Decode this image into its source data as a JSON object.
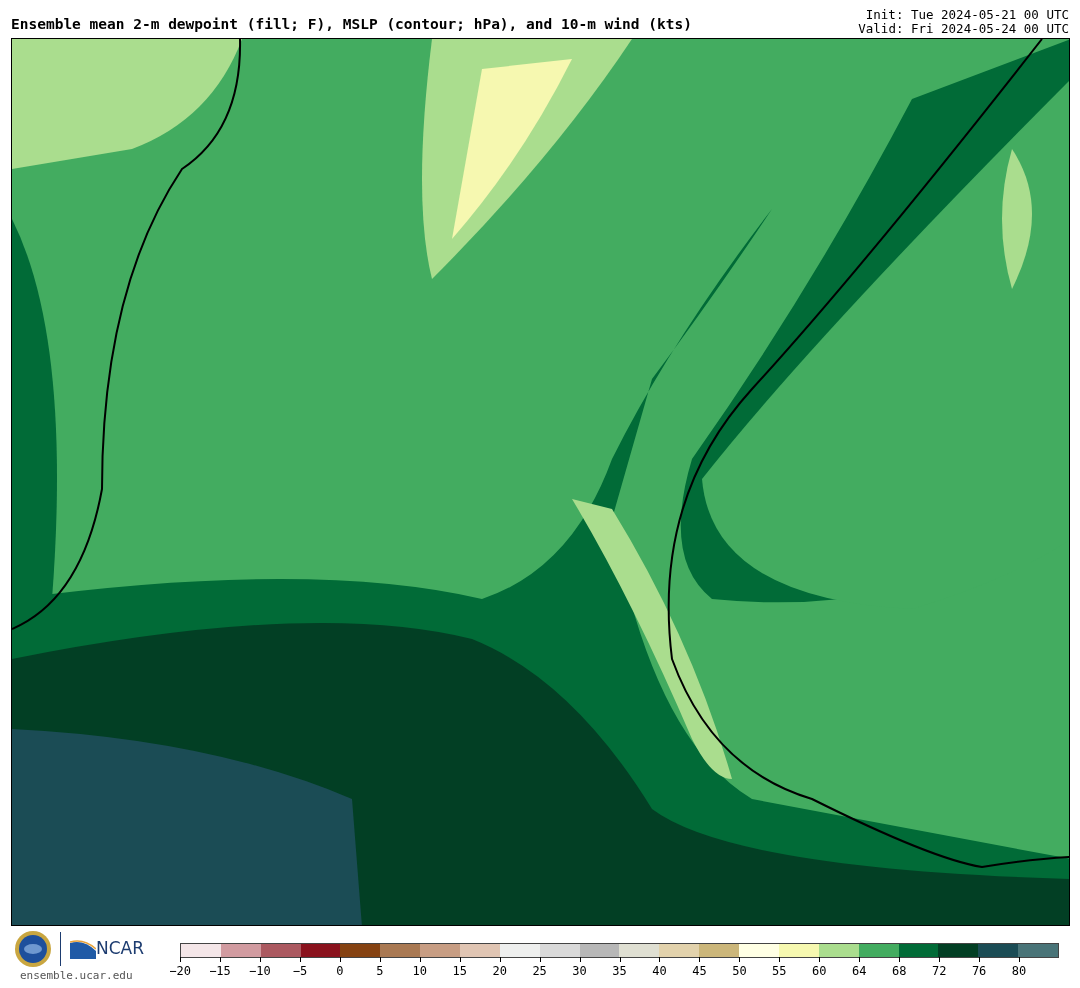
{
  "header": {
    "title": "Ensemble mean 2-m dewpoint (fill; F), MSLP (contour; hPa), and 10-m wind (kts)",
    "init": "Init: Tue 2024-05-21 00 UTC",
    "valid": "Valid: Fri 2024-05-24 00 UTC"
  },
  "footer": {
    "logo_text": "NCAR",
    "site": "ensemble.ucar.edu"
  },
  "colorbar": {
    "bins": [
      {
        "color": "#f4e6e8"
      },
      {
        "color": "#d19ba0"
      },
      {
        "color": "#ab5960"
      },
      {
        "color": "#8a121d"
      },
      {
        "color": "#854212"
      },
      {
        "color": "#a97953"
      },
      {
        "color": "#c79d83"
      },
      {
        "color": "#e0c5b3"
      },
      {
        "color": "#eeefee"
      },
      {
        "color": "#d9d9d9"
      },
      {
        "color": "#b7b7b7"
      },
      {
        "color": "#dfdfd2"
      },
      {
        "color": "#e2d2ac"
      },
      {
        "color": "#cbb67a"
      },
      {
        "color": "#ffffe4"
      },
      {
        "color": "#f6f8b0"
      },
      {
        "color": "#aadd8e"
      },
      {
        "color": "#43ac60"
      },
      {
        "color": "#016b37"
      },
      {
        "color": "#023f24"
      },
      {
        "color": "#1b4c55"
      },
      {
        "color": "#497478"
      }
    ],
    "ticks": [
      "−20",
      "−15",
      "−10",
      "−5",
      "0",
      "5",
      "10",
      "15",
      "20",
      "25",
      "30",
      "35",
      "40",
      "45",
      "50",
      "55",
      "60",
      "64",
      "68",
      "72",
      "76",
      "80"
    ]
  }
}
